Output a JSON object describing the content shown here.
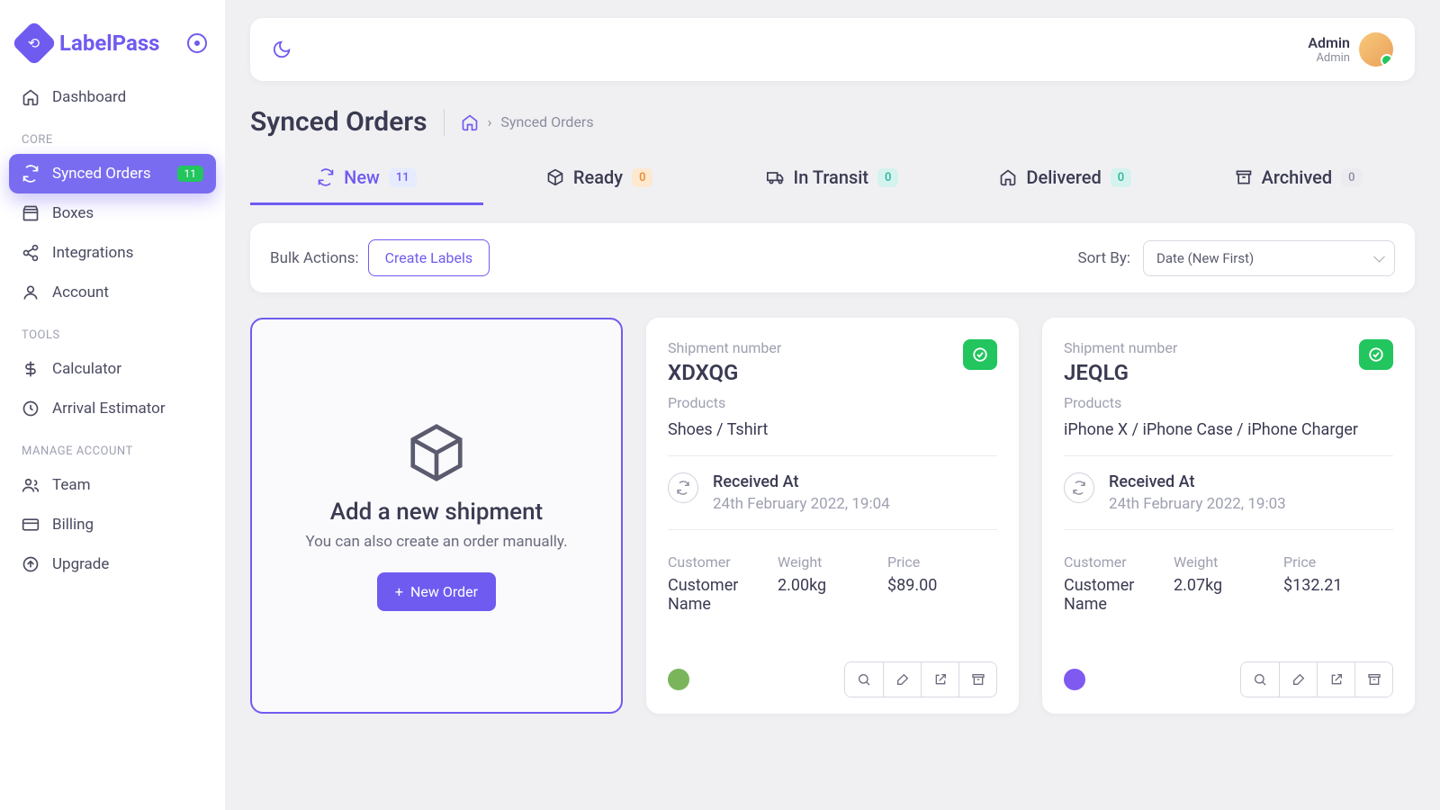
{
  "brand": "LabelPass",
  "nav": {
    "dashboard": "Dashboard",
    "sections": {
      "core": "CORE",
      "tools": "TOOLS",
      "manage": "MANAGE ACCOUNT"
    },
    "synced": "Synced Orders",
    "synced_badge": "11",
    "boxes": "Boxes",
    "integrations": "Integrations",
    "account": "Account",
    "calculator": "Calculator",
    "estimator": "Arrival Estimator",
    "team": "Team",
    "billing": "Billing",
    "upgrade": "Upgrade"
  },
  "user": {
    "name": "Admin",
    "role": "Admin"
  },
  "page": {
    "title": "Synced Orders",
    "crumb": "Synced Orders"
  },
  "tabs": {
    "new": {
      "label": "New",
      "count": "11"
    },
    "ready": {
      "label": "Ready",
      "count": "0"
    },
    "transit": {
      "label": "In Transit",
      "count": "0"
    },
    "delivered": {
      "label": "Delivered",
      "count": "0"
    },
    "archived": {
      "label": "Archived",
      "count": "0"
    }
  },
  "bulk": {
    "label": "Bulk Actions:",
    "create_labels": "Create Labels"
  },
  "sort": {
    "label": "Sort By:",
    "value": "Date (New First)"
  },
  "new_card": {
    "title": "Add a new shipment",
    "sub": "You can also create an order manually.",
    "button": "New Order"
  },
  "orders": [
    {
      "ship_lbl": "Shipment number",
      "id": "XDXQG",
      "products_lbl": "Products",
      "products": "Shoes / Tshirt",
      "recv_lbl": "Received At",
      "recv": "24th February 2022, 19:04",
      "cust_lbl": "Customer",
      "cust": "Customer Name",
      "weight_lbl": "Weight",
      "weight": "2.00kg",
      "price_lbl": "Price",
      "price": "$89.00",
      "source": "shopify"
    },
    {
      "ship_lbl": "Shipment number",
      "id": "JEQLG",
      "products_lbl": "Products",
      "products": "iPhone X / iPhone Case / iPhone Charger",
      "recv_lbl": "Received At",
      "recv": "24th February 2022, 19:03",
      "cust_lbl": "Customer",
      "cust": "Customer Name",
      "weight_lbl": "Weight",
      "weight": "2.07kg",
      "price_lbl": "Price",
      "price": "$132.21",
      "source": "woo"
    }
  ]
}
